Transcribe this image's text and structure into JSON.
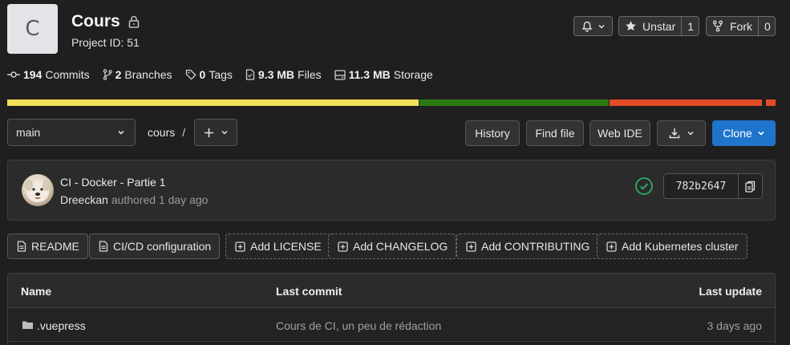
{
  "project": {
    "avatar_letter": "C",
    "name": "Cours",
    "id_label": "Project ID: 51"
  },
  "actions": {
    "notify_icon": "bell-icon",
    "unstar_label": "Unstar",
    "star_count": "1",
    "fork_label": "Fork",
    "fork_count": "0"
  },
  "stats": [
    {
      "icon": "commit-icon",
      "value": "194",
      "label": "Commits"
    },
    {
      "icon": "branch-icon",
      "value": "2",
      "label": "Branches"
    },
    {
      "icon": "tag-icon",
      "value": "0",
      "label": "Tags"
    },
    {
      "icon": "file-icon",
      "value": "9.3 MB",
      "label": "Files"
    },
    {
      "icon": "storage-icon",
      "value": "11.3 MB",
      "label": "Storage"
    }
  ],
  "language_bar": [
    {
      "color": "#f1e05a",
      "fraction": 0.536
    },
    {
      "color": "#2b7a13",
      "fraction": 0.247
    },
    {
      "color": "#e34c26",
      "fraction": 0.199
    },
    {
      "color": "#1f1f1f",
      "fraction": 0.004
    },
    {
      "color": "#e34c26",
      "fraction": 0.014
    }
  ],
  "toolbar": {
    "branch": "main",
    "path": "cours",
    "path_sep": "/",
    "history": "History",
    "find_file": "Find file",
    "web_ide": "Web IDE",
    "clone": "Clone"
  },
  "last_commit": {
    "title": "CI - Docker - Partie 1",
    "author": "Dreeckan",
    "meta": "authored 1 day ago",
    "sha": "782b2647",
    "status": "passed"
  },
  "quick_actions": [
    {
      "label": "README",
      "icon": "file-icon",
      "dashed": false
    },
    {
      "label": "CI/CD configuration",
      "icon": "file-icon",
      "dashed": false
    },
    {
      "label": "Add LICENSE",
      "icon": "plus-square-icon",
      "dashed": true
    },
    {
      "label": "Add CHANGELOG",
      "icon": "plus-square-icon",
      "dashed": true
    },
    {
      "label": "Add CONTRIBUTING",
      "icon": "plus-square-icon",
      "dashed": true
    },
    {
      "label": "Add Kubernetes cluster",
      "icon": "plus-square-icon",
      "dashed": true
    }
  ],
  "files_table": {
    "headers": {
      "name": "Name",
      "last_commit": "Last commit",
      "last_update": "Last update"
    },
    "rows": [
      {
        "name": ".vuepress",
        "type": "folder",
        "commit": "Cours de CI, un peu de rédaction",
        "updated": "3 days ago"
      }
    ]
  }
}
